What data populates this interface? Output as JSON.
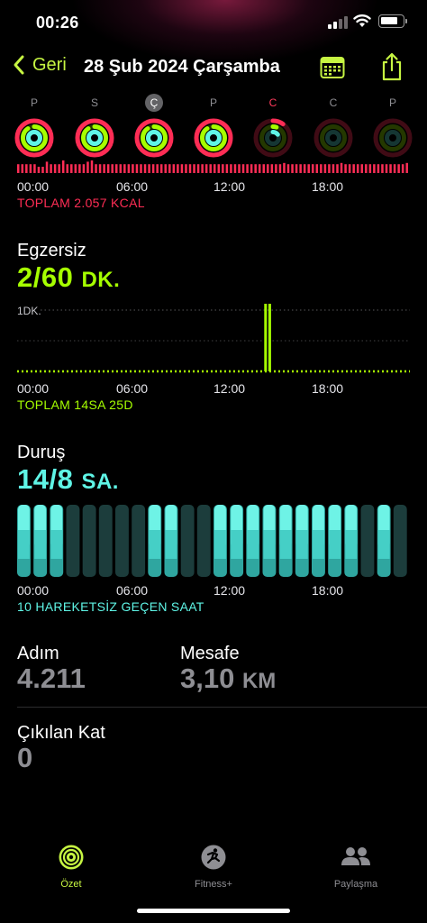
{
  "status_bar": {
    "time": "00:26"
  },
  "nav": {
    "back_label": "Geri",
    "title": "28 Şub 2024 Çarşamba"
  },
  "week": {
    "days": [
      {
        "label": "P",
        "move": 1,
        "exercise": 0.9,
        "stand": 1,
        "style": "normal"
      },
      {
        "label": "S",
        "move": 1,
        "exercise": 0.9,
        "stand": 1,
        "style": "normal"
      },
      {
        "label": "Ç",
        "move": 1,
        "exercise": 0.9,
        "stand": 1,
        "style": "today"
      },
      {
        "label": "P",
        "move": 1,
        "exercise": 0.9,
        "stand": 1,
        "style": "normal"
      },
      {
        "label": "C",
        "move": 0.1,
        "exercise": 0.05,
        "stand": 0.15,
        "style": "red"
      },
      {
        "label": "C",
        "move": 0,
        "exercise": 0,
        "stand": 0,
        "style": "normal"
      },
      {
        "label": "P",
        "move": 0,
        "exercise": 0,
        "stand": 0,
        "style": "normal"
      }
    ]
  },
  "axis_labels": [
    "00:00",
    "06:00",
    "12:00",
    "18:00"
  ],
  "move": {
    "total": "TOPLAM 2.057 KCAL",
    "hourly": [
      0.7,
      0.7,
      0.7,
      0.7,
      0.7,
      0.5,
      0.5,
      0.9,
      0.7,
      0.7,
      0.7,
      1,
      0.7,
      0.7,
      0.7,
      0.7,
      0.7,
      0.9,
      1,
      0.7,
      0.7,
      0.7,
      0.7,
      0.7,
      0.7,
      0.7,
      0.7,
      0.7,
      0.7,
      0.7,
      0.7,
      0.7,
      0.7,
      0.7,
      0.7,
      0.7,
      0.7,
      0.7,
      0.7,
      0.7,
      0.7,
      0.7,
      0.7,
      0.7,
      0.7,
      0.7,
      0.7,
      0.7,
      0.7,
      0.7,
      0.7,
      0.7,
      0.7,
      0.7,
      0.7,
      0.7,
      0.7,
      0.7,
      0.7,
      0.7,
      0.7,
      0.7,
      0.7,
      0.7,
      0.7,
      0.8,
      0.7,
      0.7,
      0.7,
      0.7,
      0.7,
      0.7,
      0.7,
      0.7,
      0.7,
      0.7,
      0.7,
      0.7,
      0.7,
      0.8,
      0.7,
      0.7,
      0.7,
      0.7,
      0.7,
      0.7,
      0.7,
      0.7,
      0.7,
      0.7,
      0.7,
      0.7,
      0.7,
      0.7,
      0.7,
      0.8
    ]
  },
  "exercise": {
    "title": "Egzersiz",
    "value": "2/60",
    "unit": "DK.",
    "scale_label": "1DK.",
    "total": "TOPLAM 14SA 25D",
    "spikes_at_hour": [
      15.1,
      15.35
    ]
  },
  "stand": {
    "title": "Duruş",
    "value": "14/8",
    "unit": "SA.",
    "summary": "10 HAREKETSİZ GEÇEN SAAT",
    "hours_stood": [
      true,
      true,
      true,
      false,
      false,
      false,
      false,
      false,
      true,
      true,
      false,
      false,
      true,
      true,
      true,
      true,
      true,
      true,
      true,
      true,
      true,
      false,
      true,
      false
    ]
  },
  "steps": {
    "label": "Adım",
    "value": "4.211"
  },
  "distance": {
    "label": "Mesafe",
    "value": "3,10",
    "unit": "KM"
  },
  "floors": {
    "label": "Çıkılan Kat",
    "value": "0"
  },
  "tabs": [
    {
      "label": "Özet",
      "icon": "summary-rings-icon",
      "active": true
    },
    {
      "label": "Fitness+",
      "icon": "fitness-plus-icon",
      "active": false
    },
    {
      "label": "Paylaşma",
      "icon": "sharing-people-icon",
      "active": false
    }
  ],
  "colors": {
    "move": "#ff2d55",
    "exercise": "#a6ff00",
    "stand": "#5ff5e6",
    "accent": "#c6f542"
  }
}
